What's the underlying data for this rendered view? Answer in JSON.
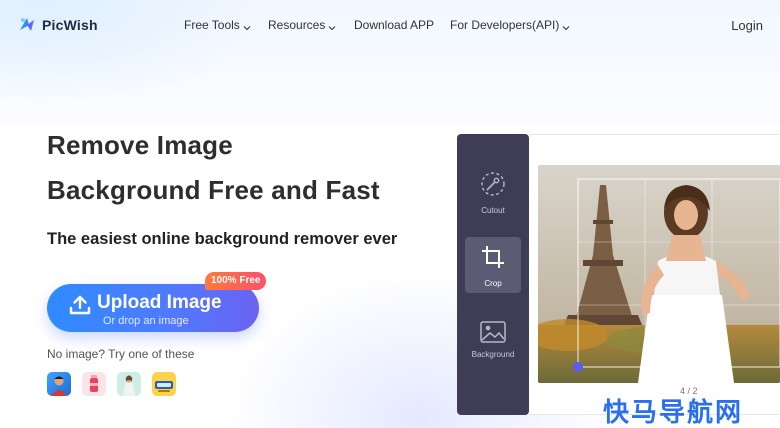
{
  "app": {
    "name": "PicWish"
  },
  "nav": {
    "items": [
      {
        "label": "Free Tools",
        "dropdown": true
      },
      {
        "label": "Resources",
        "dropdown": true
      },
      {
        "label": "Download APP",
        "dropdown": false
      },
      {
        "label": "For Developers(API)",
        "dropdown": true
      }
    ],
    "login_label": "Login"
  },
  "hero": {
    "title_line1": "Remove Image",
    "title_line2": "Background Free and Fast",
    "subtitle": "The easiest online background remover ever",
    "upload_label": "Upload Image",
    "upload_hint": "Or drop an image",
    "free_badge": "100% Free",
    "no_image_text": "No image? Try one of these",
    "samples": [
      "sample-portrait",
      "sample-drink",
      "sample-person",
      "sample-product"
    ]
  },
  "editor": {
    "tools": [
      {
        "label": "Cutout",
        "icon": "cutout-icon",
        "active": false
      },
      {
        "label": "Crop",
        "icon": "crop-icon",
        "active": true
      },
      {
        "label": "Background",
        "icon": "image-icon",
        "active": false
      }
    ],
    "page_indicator": "4 / 2"
  },
  "watermark": {
    "text": "快马导航网"
  },
  "colors": {
    "accent_start": "#2f8bff",
    "accent_end": "#6b63f2",
    "badge": "#ff5a5a",
    "panel": "#3f3d55",
    "watermark": "#2a6ff0"
  }
}
